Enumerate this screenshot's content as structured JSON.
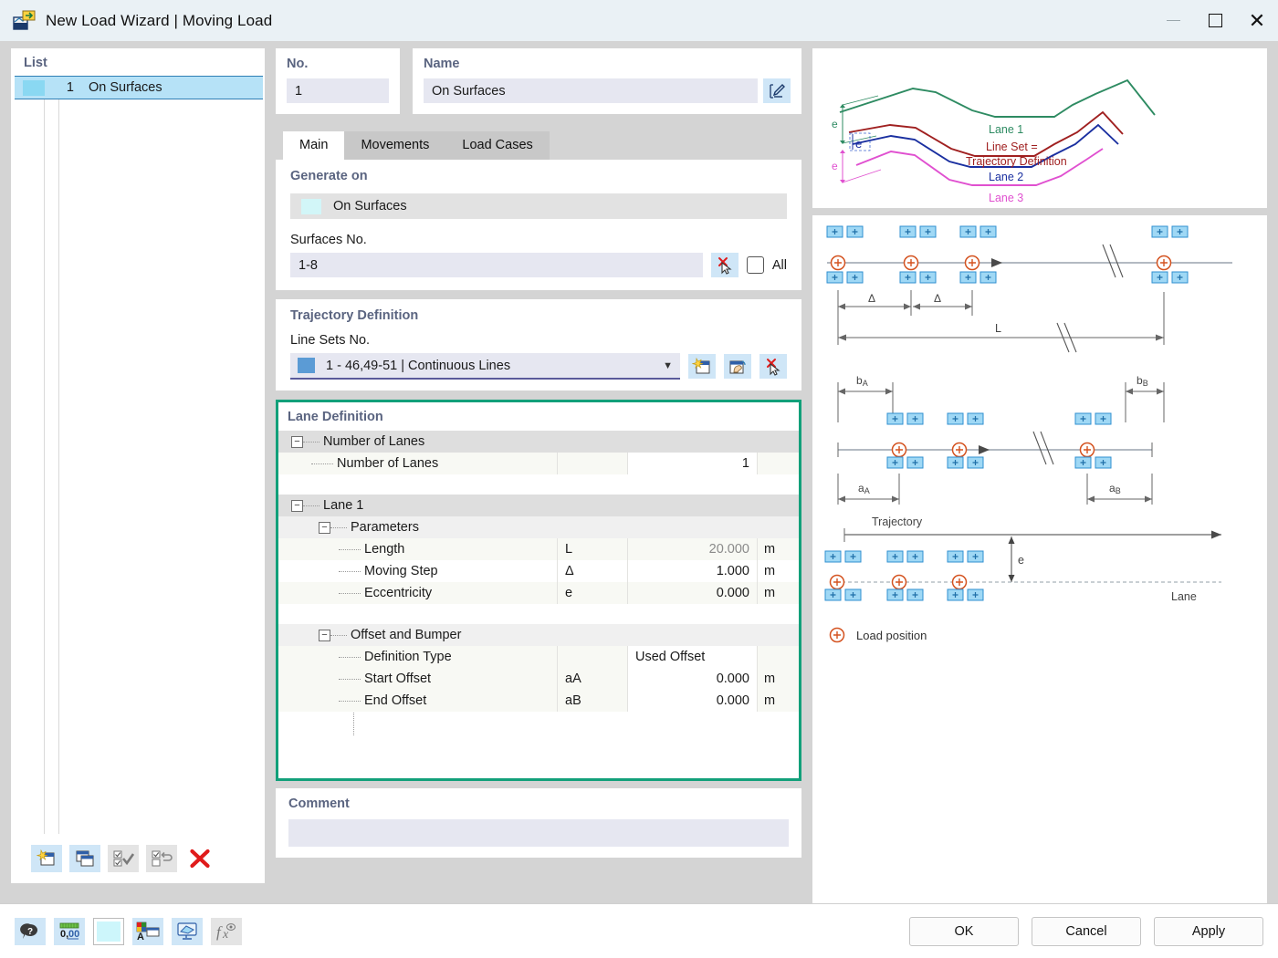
{
  "window": {
    "title": "New Load Wizard | Moving Load",
    "icon": "load-wizard-icon",
    "minimize": "minimize-icon",
    "maximize": "maximize-icon",
    "close": "close-icon"
  },
  "list_panel": {
    "title": "List",
    "rows": [
      {
        "no": "1",
        "name": "On Surfaces",
        "swatch": "#8ad8f2"
      }
    ],
    "toolbar": [
      {
        "name": "new-item-button",
        "icon": "new-window-icon"
      },
      {
        "name": "copy-item-button",
        "icon": "copy-windows-icon"
      },
      {
        "name": "select-all-button",
        "icon": "check-all-icon"
      },
      {
        "name": "invert-selection-button",
        "icon": "invert-selection-icon"
      },
      {
        "name": "delete-item-button",
        "icon": "red-x-icon"
      }
    ]
  },
  "fields": {
    "no_label": "No.",
    "no_value": "1",
    "name_label": "Name",
    "name_value": "On Surfaces",
    "name_edit_icon": "edit-pencil-icon"
  },
  "tabs": [
    {
      "label": "Main",
      "active": true
    },
    {
      "label": "Movements",
      "active": false
    },
    {
      "label": "Load Cases",
      "active": false
    }
  ],
  "generate_on": {
    "title": "Generate on",
    "selected": "On Surfaces",
    "swatch": "#d2f6f8",
    "surfaces_label": "Surfaces No.",
    "surfaces_value": "1-8",
    "pick_icon": "pick-cursor-icon",
    "all_label": "All",
    "all_checked": false
  },
  "trajectory": {
    "title": "Trajectory Definition",
    "line_sets_label": "Line Sets No.",
    "line_sets_value": "1 - 46,49-51 | Continuous Lines",
    "swatch": "#5b9bd5",
    "caret": "chevron-down-icon",
    "buttons": [
      {
        "name": "new-line-set-button",
        "icon": "new-window-star-icon"
      },
      {
        "name": "edit-line-set-button",
        "icon": "edit-hand-icon"
      },
      {
        "name": "pick-line-set-button",
        "icon": "pick-cursor-icon"
      }
    ]
  },
  "lane_definition": {
    "title": "Lane Definition",
    "highlight_color": "#12a07a",
    "groups": [
      {
        "label": "Number of Lanes",
        "expanded": true,
        "rows": [
          {
            "label": "Number of Lanes",
            "symbol": "",
            "value": "1",
            "unit": "",
            "readonly": false
          }
        ]
      },
      {
        "label": "Lane 1",
        "expanded": true,
        "subgroups": [
          {
            "label": "Parameters",
            "expanded": true,
            "rows": [
              {
                "label": "Length",
                "symbol": "L",
                "value": "20.000",
                "unit": "m",
                "readonly": true
              },
              {
                "label": "Moving Step",
                "symbol": "Δ",
                "value": "1.000",
                "unit": "m",
                "readonly": false
              },
              {
                "label": "Eccentricity",
                "symbol": "e",
                "value": "0.000",
                "unit": "m",
                "readonly": false
              }
            ]
          },
          {
            "label": "Offset and Bumper",
            "expanded": true,
            "rows": [
              {
                "label": "Definition Type",
                "symbol": "",
                "value": "Used Offset",
                "unit": "",
                "align": "left",
                "readonly": false
              },
              {
                "label": "Start Offset",
                "symbol": "aA",
                "value": "0.000",
                "unit": "m",
                "readonly": false
              },
              {
                "label": "End Offset",
                "symbol": "aB",
                "value": "0.000",
                "unit": "m",
                "readonly": false
              }
            ]
          }
        ]
      }
    ]
  },
  "comment": {
    "title": "Comment",
    "value": ""
  },
  "figure_top": {
    "labels": {
      "lane1": "Lane 1",
      "lane2": "Lane 2",
      "lane3": "Lane 3",
      "line_set_1": "Line Set =",
      "line_set_2": "Trajectory Definition",
      "e": "e"
    },
    "colors": {
      "lane1": "#2e8b62",
      "lane2": "#1a2fa0",
      "lane3": "#e050d0",
      "trajectory": "#a02020"
    }
  },
  "figure_bottom": {
    "diagram1": {
      "delta": "Δ",
      "length": "L"
    },
    "diagram2": {
      "bA": "b",
      "bA_sub": "A",
      "bB": "b",
      "bB_sub": "B",
      "aA": "a",
      "aA_sub": "A",
      "aB": "a",
      "aB_sub": "B"
    },
    "diagram3": {
      "trajectory": "Trajectory",
      "e": "e",
      "lane": "Lane"
    },
    "legend": {
      "text": "Load position",
      "marker": "load-position-icon"
    }
  },
  "bottom_bar": {
    "tools": [
      {
        "name": "help-button",
        "icon": "question-balloon-icon"
      },
      {
        "name": "decimal-places-button",
        "icon": "number-format-icon"
      },
      {
        "name": "color-button",
        "icon": "color-swatch-icon"
      },
      {
        "name": "display-properties-button",
        "icon": "palette-window-icon"
      },
      {
        "name": "visibility-button",
        "icon": "view-monitor-icon"
      },
      {
        "name": "formula-button",
        "icon": "fx-icon"
      }
    ],
    "ok": "OK",
    "cancel": "Cancel",
    "apply": "Apply"
  }
}
